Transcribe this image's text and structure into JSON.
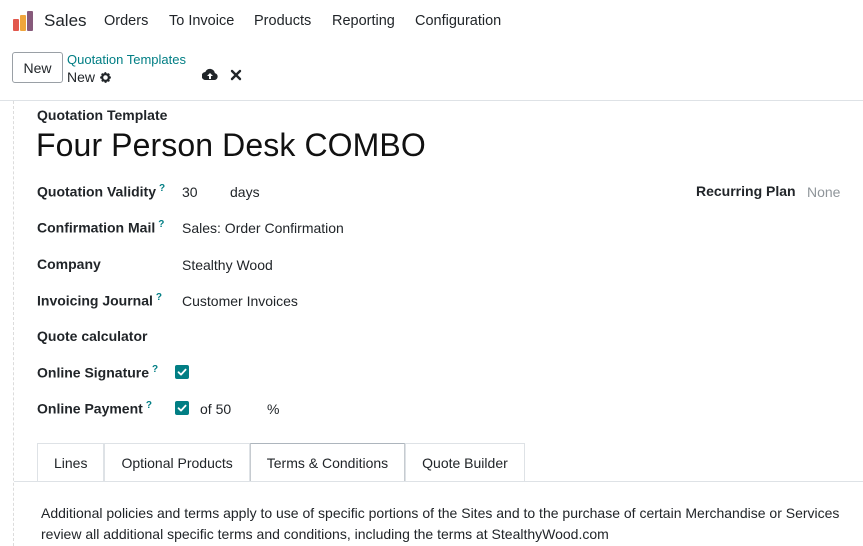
{
  "nav": {
    "app_name": "Sales",
    "menu": [
      "Orders",
      "To Invoice",
      "Products",
      "Reporting",
      "Configuration"
    ]
  },
  "control_panel": {
    "new_label": "New",
    "breadcrumb_parent": "Quotation Templates",
    "breadcrumb_current": "New"
  },
  "form": {
    "label": "Quotation Template",
    "title": "Four Person Desk COMBO",
    "fields": {
      "validity_label": "Quotation Validity",
      "validity_value": "30",
      "validity_unit": "days",
      "recurring_label": "Recurring Plan",
      "recurring_value": "None",
      "mail_label": "Confirmation Mail",
      "mail_value": "Sales: Order Confirmation",
      "company_label": "Company",
      "company_value": "Stealthy Wood",
      "journal_label": "Invoicing Journal",
      "journal_value": "Customer Invoices",
      "calculator_label": "Quote calculator",
      "signature_label": "Online Signature",
      "signature_checked": true,
      "payment_label": "Online Payment",
      "payment_checked": true,
      "payment_of": "of 50",
      "payment_unit": "%",
      "help_mark": "?"
    },
    "tabs": [
      "Lines",
      "Optional Products",
      "Terms & Conditions",
      "Quote Builder"
    ],
    "active_tab": "Terms & Conditions",
    "terms_line1": "Additional policies and terms apply to use of specific portions of the Sites and to the purchase of certain Merchandise or Services",
    "terms_line2": "review all additional specific terms and conditions, including the terms at StealthyWood.com"
  },
  "colors": {
    "accent": "#017e84",
    "logo_orange": "#f0a63c",
    "logo_red": "#e2584d",
    "logo_purple": "#875a7b"
  },
  "icons": {
    "logo": "sales-app-icon",
    "gear": "gear-icon",
    "save": "cloud-upload-icon",
    "discard": "close-icon",
    "check": "check-icon"
  }
}
